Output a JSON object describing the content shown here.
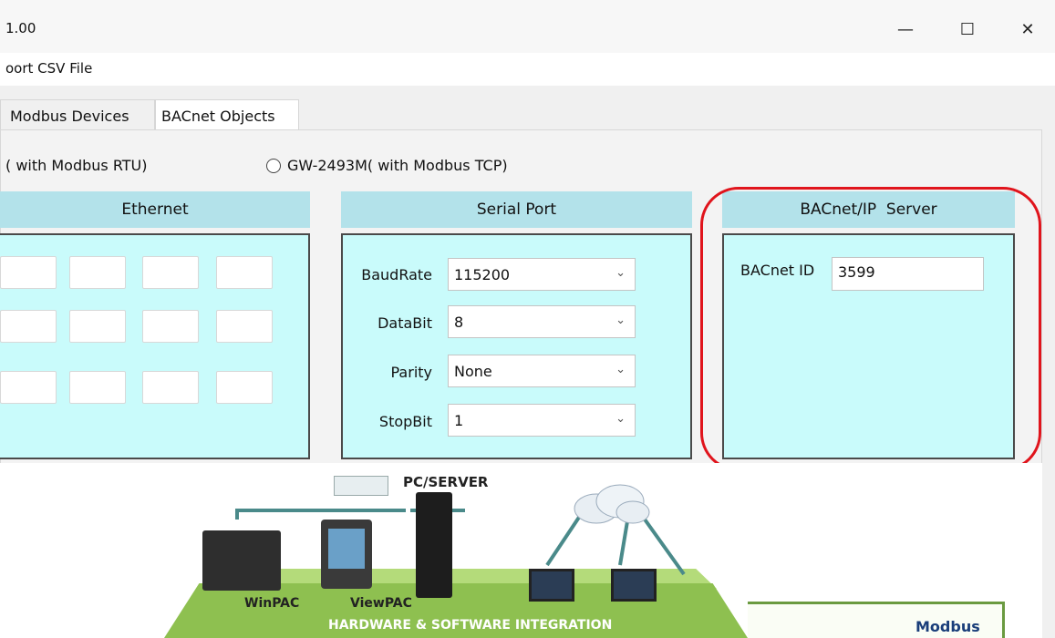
{
  "window": {
    "title": "1.00",
    "controls": {
      "minimize": "—",
      "maximize": "☐",
      "close": "✕"
    }
  },
  "menu": {
    "item": "oort CSV File"
  },
  "tabs": [
    {
      "label": "Modbus Devices",
      "active": false
    },
    {
      "label": "BACnet Objects",
      "active": true
    }
  ],
  "mode": {
    "option1_label": "( with Modbus RTU)",
    "option2_label": "GW-2493M( with Modbus TCP)",
    "option2_selected": false
  },
  "ethernet": {
    "title": "Ethernet"
  },
  "serial": {
    "title": "Serial Port",
    "fields": [
      {
        "label": "BaudRate",
        "value": "115200"
      },
      {
        "label": "DataBit",
        "value": "8"
      },
      {
        "label": "Parity",
        "value": "None"
      },
      {
        "label": "StopBit",
        "value": "1"
      }
    ]
  },
  "bacnet": {
    "title": "BACnet/IP  Server",
    "id_label": "BACnet ID",
    "id_value": "3599"
  },
  "banner": {
    "pc_server": "PC/SERVER",
    "winpac": "WinPAC",
    "viewpac": "ViewPAC",
    "integration": "HARDWARE & SOFTWARE INTEGRATION",
    "modbus": "Modbus"
  },
  "colors": {
    "group_header": "#b3e2ea",
    "group_panel": "#c9fbfb",
    "highlight": "#e0141c",
    "platform": "#8ec050"
  },
  "icons": {
    "combo_arrow": "chevron-down-icon",
    "radio": "radio-icon"
  }
}
